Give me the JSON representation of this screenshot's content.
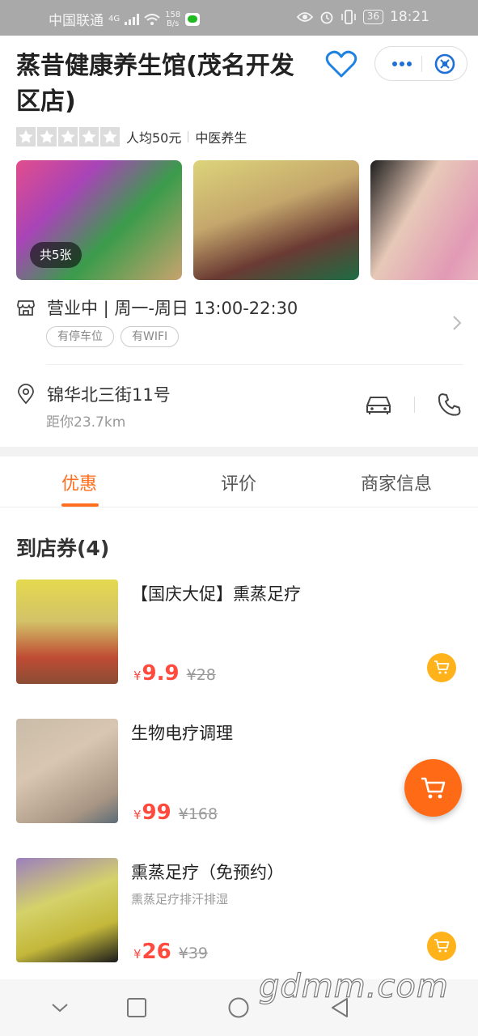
{
  "status_bar": {
    "carrier": "中国联通",
    "network": "4G",
    "speed_value": "158",
    "speed_unit": "B/s",
    "battery": "36",
    "time": "18:21"
  },
  "shop": {
    "title": "蒸昔健康养生馆(茂名开发区店)",
    "rating_stars": 0,
    "per_capita": "人均50元",
    "category": "中医养生",
    "photo_count": "共5张",
    "hours": "营业中 | 周一-周日 13:00-22:30",
    "tags": [
      "有停车位",
      "有WIFI"
    ],
    "address": "锦华北三街11号",
    "distance": "距你23.7km"
  },
  "tabs": [
    "优惠",
    "评价",
    "商家信息"
  ],
  "active_tab": 0,
  "coupons": {
    "title": "到店券(4)",
    "items": [
      {
        "name": "【国庆大促】熏蒸足疗",
        "subtitle": "",
        "currency": "¥",
        "price": "9.9",
        "original_price": "¥28"
      },
      {
        "name": "生物电疗调理",
        "subtitle": "",
        "currency": "¥",
        "price": "99",
        "original_price": "¥168"
      },
      {
        "name": "熏蒸足疗（免预约）",
        "subtitle": "熏蒸足疗排汗排湿",
        "currency": "¥",
        "price": "26",
        "original_price": "¥39"
      }
    ]
  },
  "watermark": "gdmm.com",
  "colors": {
    "accent": "#ff6f1f",
    "price": "#ff4a3d",
    "cart_small": "#ffb21a",
    "cart_fab": "#ff6a16",
    "favorite": "#1f82e0"
  },
  "icons": {
    "favorite": "heart-outline-icon",
    "more": "more-dots-icon",
    "close": "close-circle-icon",
    "store": "store-icon",
    "location": "location-pin-icon",
    "car": "car-icon",
    "phone": "phone-icon",
    "cart": "cart-icon"
  }
}
